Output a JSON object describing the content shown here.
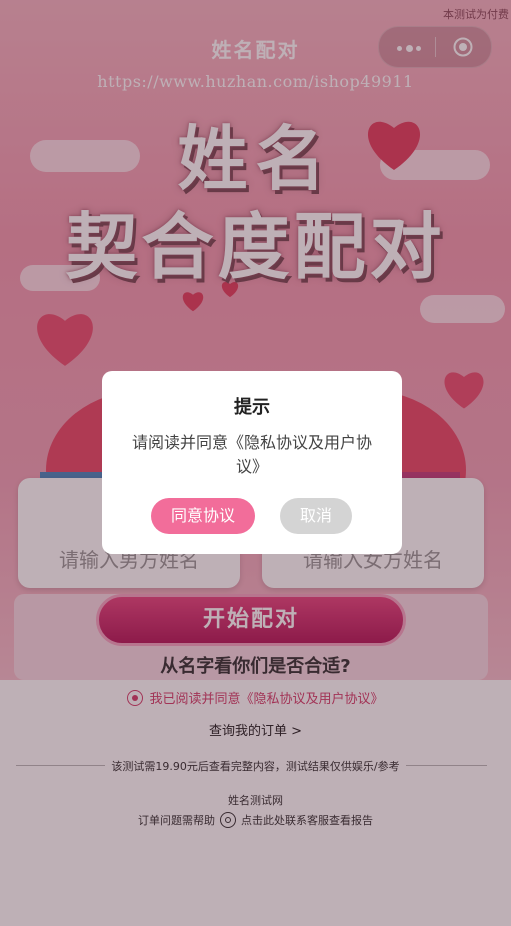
{
  "corner_note": "本测试为付费",
  "nav": {
    "title": "姓名配对"
  },
  "url_watermark": "https://www.huzhan.com/ishop49911",
  "hero": {
    "line1": "姓名",
    "line2": "契合度配对"
  },
  "form": {
    "male_placeholder": "请输入男方姓名",
    "female_placeholder": "请输入女方姓名",
    "start_button": "开始配对",
    "subtitle": "从名字看你们是否合适?"
  },
  "footer": {
    "agree_text": "我已阅读并同意《隐私协议及用户协议》",
    "orders_link": "查询我的订单 >",
    "price_note": "该测试需19.90元后查看完整内容，测试结果仅供娱乐/参考",
    "site_name": "姓名测试网",
    "help_prefix": "订单问题需帮助",
    "help_suffix": "点击此处联系客服查看报告"
  },
  "dialog": {
    "title": "提示",
    "body": "请阅读并同意《隐私协议及用户协议》",
    "agree_button": "同意协议",
    "cancel_button": "取消"
  },
  "colors": {
    "accent_pink": "#f26d9a",
    "start_button": "#c4235f",
    "male_tab": "#4a88bd",
    "female_tab": "#c23f7c",
    "agree_text": "#d4406c"
  },
  "icons": [
    "more-dots-icon",
    "target-close-icon",
    "heart-icon",
    "radio-icon",
    "support-icon"
  ]
}
